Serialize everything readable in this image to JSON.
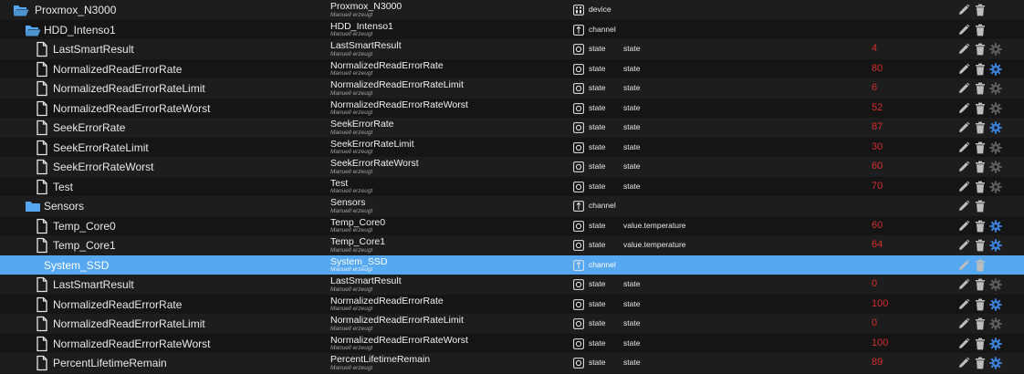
{
  "colors": {
    "row_even": "#1d1d1d",
    "row_odd": "#151515",
    "selected": "#56a9f1",
    "value_red": "#d42f2f",
    "config_active": "#3b7fd6",
    "config_inactive": "#5c5c5c",
    "icon_gray": "#bdbdbd",
    "folder_blue": "#56a9f1"
  },
  "rows": [
    {
      "level": 0,
      "icon": "folder-open-icon",
      "id": "Proxmox_N3000",
      "name": "Proxmox_N3000",
      "sub": "Manuell erzeugt",
      "type": "device",
      "type_icon": "device-icon",
      "role": "",
      "value": "",
      "actions": [
        "edit",
        "delete"
      ],
      "config": "none",
      "selected": false
    },
    {
      "level": 1,
      "icon": "folder-open-icon",
      "id": "HDD_Intenso1",
      "name": "HDD_Intenso1",
      "sub": "Manuell erzeugt",
      "type": "channel",
      "type_icon": "channel-icon",
      "role": "",
      "value": "",
      "actions": [
        "edit",
        "delete"
      ],
      "config": "none",
      "selected": false
    },
    {
      "level": 2,
      "icon": "file-icon",
      "id": "LastSmartResult",
      "name": "LastSmartResult",
      "sub": "Manuell erzeugt",
      "type": "state",
      "type_icon": "state-icon",
      "role": "state",
      "value": "4",
      "actions": [
        "edit",
        "delete",
        "config"
      ],
      "config": "inactive",
      "selected": false
    },
    {
      "level": 2,
      "icon": "file-icon",
      "id": "NormalizedReadErrorRate",
      "name": "NormalizedReadErrorRate",
      "sub": "Manuell erzeugt",
      "type": "state",
      "type_icon": "state-icon",
      "role": "state",
      "value": "80",
      "actions": [
        "edit",
        "delete",
        "config"
      ],
      "config": "active",
      "selected": false
    },
    {
      "level": 2,
      "icon": "file-icon",
      "id": "NormalizedReadErrorRateLimit",
      "name": "NormalizedReadErrorRateLimit",
      "sub": "Manuell erzeugt",
      "type": "state",
      "type_icon": "state-icon",
      "role": "state",
      "value": "6",
      "actions": [
        "edit",
        "delete",
        "config"
      ],
      "config": "inactive",
      "selected": false
    },
    {
      "level": 2,
      "icon": "file-icon",
      "id": "NormalizedReadErrorRateWorst",
      "name": "NormalizedReadErrorRateWorst",
      "sub": "Manuell erzeugt",
      "type": "state",
      "type_icon": "state-icon",
      "role": "state",
      "value": "52",
      "actions": [
        "edit",
        "delete",
        "config"
      ],
      "config": "inactive",
      "selected": false
    },
    {
      "level": 2,
      "icon": "file-icon",
      "id": "SeekErrorRate",
      "name": "SeekErrorRate",
      "sub": "Manuell erzeugt",
      "type": "state",
      "type_icon": "state-icon",
      "role": "state",
      "value": "87",
      "actions": [
        "edit",
        "delete",
        "config"
      ],
      "config": "active",
      "selected": false
    },
    {
      "level": 2,
      "icon": "file-icon",
      "id": "SeekErrorRateLimit",
      "name": "SeekErrorRateLimit",
      "sub": "Manuell erzeugt",
      "type": "state",
      "type_icon": "state-icon",
      "role": "state",
      "value": "30",
      "actions": [
        "edit",
        "delete",
        "config"
      ],
      "config": "inactive",
      "selected": false
    },
    {
      "level": 2,
      "icon": "file-icon",
      "id": "SeekErrorRateWorst",
      "name": "SeekErrorRateWorst",
      "sub": "Manuell erzeugt",
      "type": "state",
      "type_icon": "state-icon",
      "role": "state",
      "value": "60",
      "actions": [
        "edit",
        "delete",
        "config"
      ],
      "config": "inactive",
      "selected": false
    },
    {
      "level": 2,
      "icon": "file-icon",
      "id": "Test",
      "name": "Test",
      "sub": "Manuell erzeugt",
      "type": "state",
      "type_icon": "state-icon",
      "role": "state",
      "value": "70",
      "actions": [
        "edit",
        "delete",
        "config"
      ],
      "config": "inactive",
      "selected": false
    },
    {
      "level": 1,
      "icon": "folder-closed-icon",
      "id": "Sensors",
      "name": "Sensors",
      "sub": "Manuell erzeugt",
      "type": "channel",
      "type_icon": "channel-icon",
      "role": "",
      "value": "",
      "actions": [
        "edit",
        "delete"
      ],
      "config": "none",
      "selected": false
    },
    {
      "level": 2,
      "icon": "file-icon",
      "id": "Temp_Core0",
      "name": "Temp_Core0",
      "sub": "Manuell erzeugt",
      "type": "state",
      "type_icon": "state-icon",
      "role": "value.temperature",
      "value": "60",
      "actions": [
        "edit",
        "delete",
        "config"
      ],
      "config": "active",
      "selected": false
    },
    {
      "level": 2,
      "icon": "file-icon",
      "id": "Temp_Core1",
      "name": "Temp_Core1",
      "sub": "Manuell erzeugt",
      "type": "state",
      "type_icon": "state-icon",
      "role": "value.temperature",
      "value": "64",
      "actions": [
        "edit",
        "delete",
        "config"
      ],
      "config": "active",
      "selected": false
    },
    {
      "level": 1,
      "icon": "folder-open-icon",
      "id": "System_SSD",
      "name": "System_SSD",
      "sub": "Manuell erzeugt",
      "type": "channel",
      "type_icon": "channel-icon",
      "role": "",
      "value": "",
      "actions": [
        "edit",
        "delete"
      ],
      "config": "none",
      "selected": true
    },
    {
      "level": 2,
      "icon": "file-icon",
      "id": "LastSmartResult",
      "name": "LastSmartResult",
      "sub": "Manuell erzeugt",
      "type": "state",
      "type_icon": "state-icon",
      "role": "state",
      "value": "0",
      "actions": [
        "edit",
        "delete",
        "config"
      ],
      "config": "inactive",
      "selected": false
    },
    {
      "level": 2,
      "icon": "file-icon",
      "id": "NormalizedReadErrorRate",
      "name": "NormalizedReadErrorRate",
      "sub": "Manuell erzeugt",
      "type": "state",
      "type_icon": "state-icon",
      "role": "state",
      "value": "100",
      "actions": [
        "edit",
        "delete",
        "config"
      ],
      "config": "active",
      "selected": false
    },
    {
      "level": 2,
      "icon": "file-icon",
      "id": "NormalizedReadErrorRateLimit",
      "name": "NormalizedReadErrorRateLimit",
      "sub": "Manuell erzeugt",
      "type": "state",
      "type_icon": "state-icon",
      "role": "state",
      "value": "0",
      "actions": [
        "edit",
        "delete",
        "config"
      ],
      "config": "inactive",
      "selected": false
    },
    {
      "level": 2,
      "icon": "file-icon",
      "id": "NormalizedReadErrorRateWorst",
      "name": "NormalizedReadErrorRateWorst",
      "sub": "Manuell erzeugt",
      "type": "state",
      "type_icon": "state-icon",
      "role": "state",
      "value": "100",
      "actions": [
        "edit",
        "delete",
        "config"
      ],
      "config": "active",
      "selected": false
    },
    {
      "level": 2,
      "icon": "file-icon",
      "id": "PercentLifetimeRemain",
      "name": "PercentLifetimeRemain",
      "sub": "Manuell erzeugt",
      "type": "state",
      "type_icon": "state-icon",
      "role": "state",
      "value": "89",
      "actions": [
        "edit",
        "delete",
        "config"
      ],
      "config": "active",
      "selected": false
    }
  ]
}
